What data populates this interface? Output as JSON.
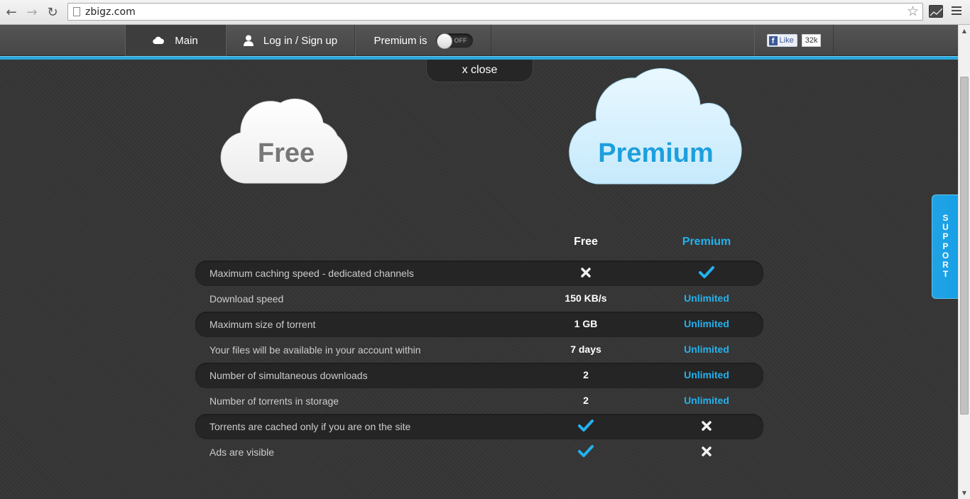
{
  "browser": {
    "url": "zbigz.com",
    "back_glyph": "←",
    "forward_glyph": "→",
    "reload_glyph": "↻",
    "star_glyph": "☆"
  },
  "nav": {
    "main_label": "Main",
    "login_label": "Log in / Sign up",
    "premium_label": "Premium is",
    "toggle_state": "OFF",
    "fb_like": "Like",
    "fb_f": "f",
    "fb_count": "32k"
  },
  "close_label": "x close",
  "support_letters": [
    "S",
    "U",
    "P",
    "P",
    "O",
    "R",
    "T"
  ],
  "clouds": {
    "free": "Free",
    "premium": "Premium"
  },
  "columns": {
    "free": "Free",
    "premium": "Premium"
  },
  "rows": [
    {
      "feature": "Maximum caching speed - dedicated channels",
      "free": "cross",
      "premium": "check"
    },
    {
      "feature": "Download speed",
      "free": "150 KB/s",
      "premium": "Unlimited"
    },
    {
      "feature": "Maximum size of torrent",
      "free": "1 GB",
      "premium": "Unlimited"
    },
    {
      "feature": "Your files will be available in your account within",
      "free": "7 days",
      "premium": "Unlimited"
    },
    {
      "feature": "Number of simultaneous downloads",
      "free": "2",
      "premium": "Unlimited"
    },
    {
      "feature": "Number of torrents in storage",
      "free": "2",
      "premium": "Unlimited"
    },
    {
      "feature": "Torrents are cached only if you are on the site",
      "free": "check",
      "premium": "cross"
    },
    {
      "feature": "Ads are visible",
      "free": "check",
      "premium": "cross"
    }
  ],
  "colors": {
    "accent": "#23b2ee",
    "premium_cloud_text": "#1e9fdd",
    "free_cloud_text": "#777777"
  },
  "icons": {
    "check": "check-icon",
    "cross": "cross-icon"
  }
}
